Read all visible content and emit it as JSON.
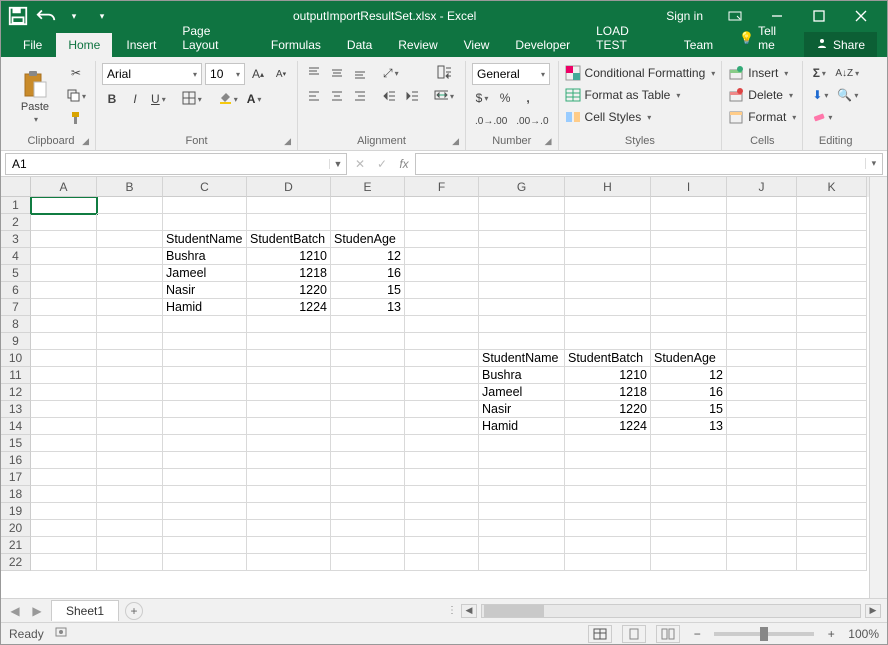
{
  "titlebar": {
    "title": "outputImportResultSet.xlsx - Excel",
    "signin": "Sign in"
  },
  "tabs": {
    "file": "File",
    "home": "Home",
    "insert": "Insert",
    "pagelayout": "Page Layout",
    "formulas": "Formulas",
    "data": "Data",
    "review": "Review",
    "view": "View",
    "developer": "Developer",
    "loadtest": "LOAD TEST",
    "team": "Team",
    "tellme": "Tell me",
    "share": "Share"
  },
  "ribbon": {
    "clipboard": {
      "label": "Clipboard",
      "paste_label": "Paste"
    },
    "font": {
      "label": "Font",
      "name": "Arial",
      "size": "10"
    },
    "alignment": {
      "label": "Alignment"
    },
    "number": {
      "label": "Number",
      "format": "General"
    },
    "styles": {
      "label": "Styles",
      "condfmt": "Conditional Formatting",
      "table": "Format as Table",
      "cellstyles": "Cell Styles"
    },
    "cells": {
      "label": "Cells",
      "insert": "Insert",
      "delete": "Delete",
      "format": "Format"
    },
    "editing": {
      "label": "Editing"
    }
  },
  "namebox": "A1",
  "formula": "",
  "columns": [
    "A",
    "B",
    "C",
    "D",
    "E",
    "F",
    "G",
    "H",
    "I",
    "J",
    "K"
  ],
  "rowcount": 22,
  "table1": {
    "startRow": 3,
    "startCol": 2,
    "headers": [
      "StudentName",
      "StudentBatch",
      "StudenAge"
    ],
    "rows": [
      [
        "Bushra",
        "1210",
        "12"
      ],
      [
        "Jameel",
        "1218",
        "16"
      ],
      [
        "Nasir",
        "1220",
        "15"
      ],
      [
        "Hamid",
        "1224",
        "13"
      ]
    ]
  },
  "table2": {
    "startRow": 10,
    "startCol": 6,
    "headers": [
      "StudentName",
      "StudentBatch",
      "StudenAge"
    ],
    "rows": [
      [
        "Bushra",
        "1210",
        "12"
      ],
      [
        "Jameel",
        "1218",
        "16"
      ],
      [
        "Nasir",
        "1220",
        "15"
      ],
      [
        "Hamid",
        "1224",
        "13"
      ]
    ]
  },
  "colNumericAlign": {
    "table1": [
      false,
      true,
      true
    ],
    "table2": [
      false,
      true,
      true
    ]
  },
  "sheets": {
    "active": "Sheet1"
  },
  "status": {
    "ready": "Ready",
    "zoom": "100%"
  },
  "colors": {
    "accent": "#0f7441"
  }
}
